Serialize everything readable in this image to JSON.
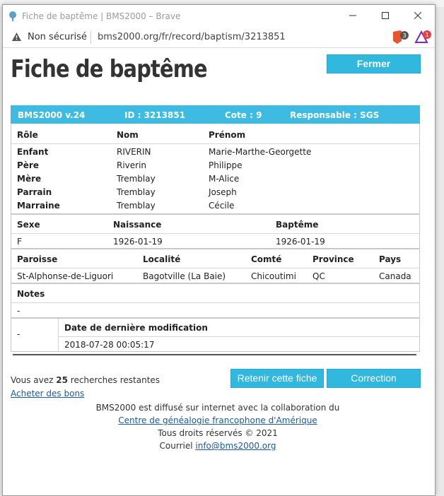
{
  "window": {
    "title": "Fiche de baptême | BMS2000 – Brave"
  },
  "address": {
    "security": "Non sécurisé",
    "url": "bms2000.org/fr/record/baptism/3213851",
    "shield_count": "3",
    "bat_count": "1"
  },
  "page": {
    "title": "Fiche de baptême",
    "close_label": "Fermer"
  },
  "record_header": {
    "version": "BMS2000 v.24",
    "id": "ID : 3213851",
    "cote": "Cote : 9",
    "responsable": "Responsable : SGS"
  },
  "persons": {
    "headers": [
      "Rôle",
      "Nom",
      "Prénom"
    ],
    "rows": [
      {
        "role": "Enfant",
        "nom": "RIVERIN",
        "prenom": "Marie-Marthe-Georgette"
      },
      {
        "role": "Père",
        "nom": "Riverin",
        "prenom": "Philippe"
      },
      {
        "role": "Mère",
        "nom": "Tremblay",
        "prenom": "M-Alice"
      },
      {
        "role": "Parrain",
        "nom": "Tremblay",
        "prenom": "Joseph"
      },
      {
        "role": "Marraine",
        "nom": "Tremblay",
        "prenom": "Cécile"
      }
    ]
  },
  "birth": {
    "headers": [
      "Sexe",
      "Naissance",
      "Baptême"
    ],
    "values": [
      "F",
      "1926-01-19",
      "1926-01-19"
    ]
  },
  "place": {
    "headers": [
      "Paroisse",
      "Localité",
      "Comté",
      "Province",
      "Pays"
    ],
    "values": [
      "St-Alphonse-de-Liguori",
      "Bagotville (La Baie)",
      "Chicoutimi",
      "QC",
      "Canada"
    ]
  },
  "notes": {
    "header": "Notes",
    "value": "-"
  },
  "modif": {
    "left": "-",
    "header": "Date de dernière modification",
    "value": "2018-07-28 00:05:17"
  },
  "bottom": {
    "prefix": "Vous avez ",
    "count": "25",
    "suffix": " recherches restantes",
    "buy_link": "Acheter des bons",
    "retain_label": "Retenir cette fiche",
    "correction_label": "Correction"
  },
  "footer": {
    "line1": "BMS2000 est diffusé sur internet avec la collaboration du",
    "link": "Centre de généalogie francophone d'Amérique",
    "rights": "Tous droits réservés © 2021",
    "mail_prefix": "Courriel ",
    "mail": "info@bms2000.org"
  },
  "colors": {
    "accent": "#3dbbe2",
    "button": "#31b8df",
    "link": "#1a5aa0"
  }
}
